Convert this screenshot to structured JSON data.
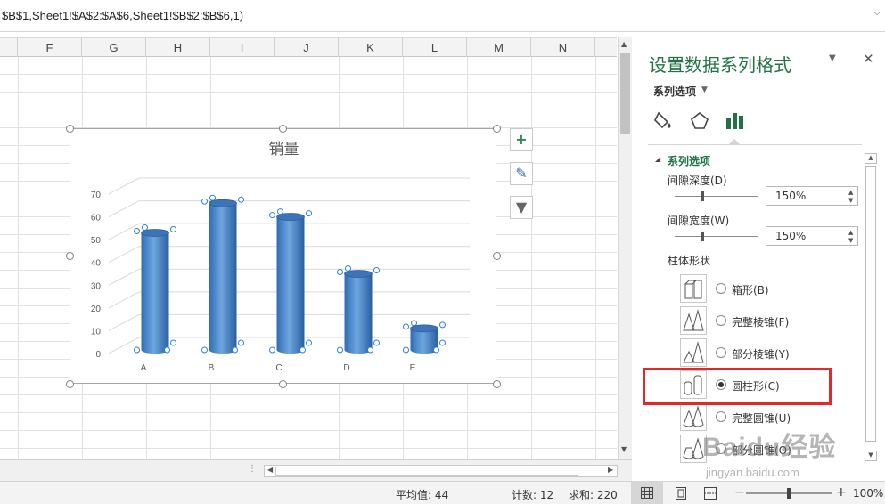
{
  "formula_bar": {
    "text": "$B$1,Sheet1!$A$2:$A$6,Sheet1!$B$2:$B$6,1)"
  },
  "columns": [
    "F",
    "G",
    "H",
    "I",
    "J",
    "K",
    "L",
    "M",
    "N"
  ],
  "chart": {
    "title": "销量",
    "y_ticks": [
      "70",
      "60",
      "50",
      "40",
      "30",
      "20",
      "10",
      "0"
    ],
    "x_ticks": [
      "A",
      "B",
      "C",
      "D",
      "E"
    ]
  },
  "chart_data": {
    "type": "bar",
    "title": "销量",
    "categories": [
      "A",
      "B",
      "C",
      "D",
      "E"
    ],
    "values": [
      53,
      66,
      60,
      35,
      11
    ],
    "ylim": [
      0,
      70
    ],
    "xlabel": "",
    "ylabel": "",
    "grid": true,
    "bar_shape": "cylinder",
    "series_color": "#4a86c8"
  },
  "chart_buttons": {
    "add": "+",
    "style": "✎",
    "filter": "▼"
  },
  "status_bar": {
    "average": "平均值: 44",
    "count": "计数: 12",
    "sum": "求和: 220",
    "zoom_minus": "−",
    "zoom_plus": "+",
    "zoom": "100%",
    "zoom_level": 1.0
  },
  "pane": {
    "title": "设置数据系列格式",
    "dropdown_icon": "▼",
    "close": "✕",
    "subtitle": "系列选项",
    "section": "系列选项",
    "gap_depth_label": "间隙深度(D)",
    "gap_depth_value": "150%",
    "gap_width_label": "间隙宽度(W)",
    "gap_width_value": "150%",
    "shape_label": "柱体形状",
    "options": [
      {
        "label": "箱形(B)",
        "checked": false
      },
      {
        "label": "完整棱锥(F)",
        "checked": false
      },
      {
        "label": "部分棱锥(Y)",
        "checked": false
      },
      {
        "label": "圆柱形(C)",
        "checked": true
      },
      {
        "label": "完整圆锥(U)",
        "checked": false
      },
      {
        "label": "部分圆锥(O)",
        "checked": false
      }
    ]
  },
  "watermark": {
    "line1": "Baidu经验",
    "line2": "jingyan.baidu.com"
  },
  "colors": {
    "accent": "#217346",
    "highlight": "#e2282a",
    "bar": "#4a86c8"
  }
}
